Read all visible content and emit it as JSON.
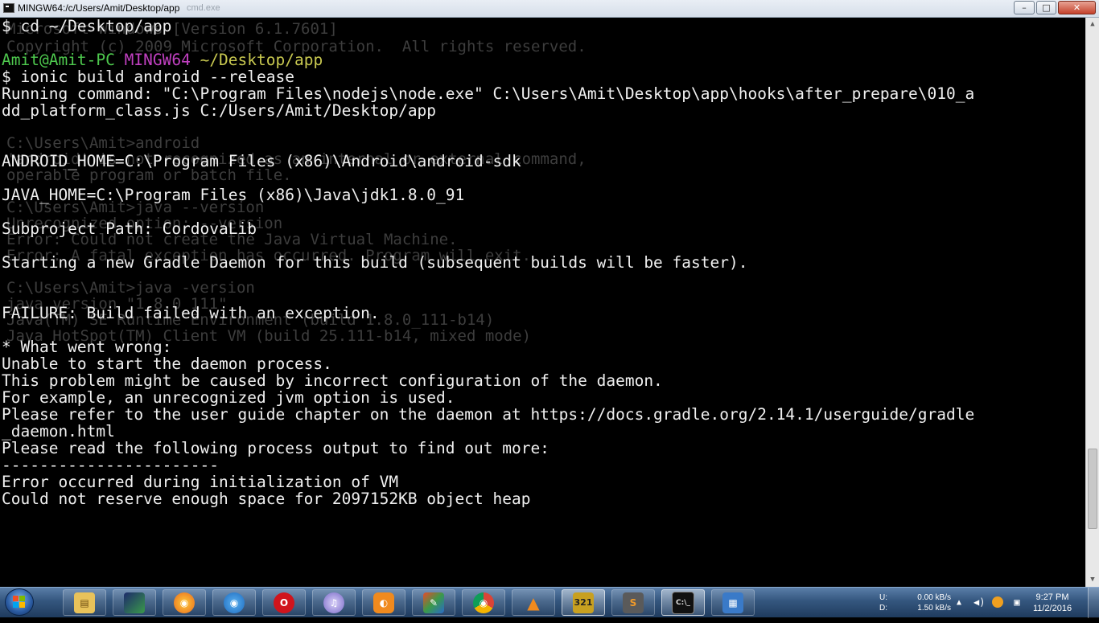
{
  "window": {
    "title": "MINGW64:/c/Users/Amit/Desktop/app",
    "title_ghost": "cmd.exe",
    "controls": {
      "minimize": "–",
      "maximize": "□",
      "close": "✕"
    }
  },
  "terminal": {
    "colors": {
      "background": "#000000",
      "text": "#f0f0f0",
      "user_host": "#4ec94e",
      "mingw": "#c040c0",
      "path": "#c8c850"
    },
    "ghost_text": [
      "Microsoft Windows [Version 6.1.7601]",
      "Copyright (c) 2009 Microsoft Corporation.  All rights reserved.",
      "C:\\Users\\Amit>android",
      "'android' is not recognized as an internal or external command,",
      "operable program or batch file.",
      "C:\\Users\\Amit>java --version",
      "Unrecognized option: --version",
      "Error: Could not create the Java Virtual Machine.",
      "Error: A fatal exception has occurred. Program will exit.",
      "C:\\Users\\Amit>java -version",
      "java version \"1.8.0_111\"",
      "Java(TM) SE Runtime Environment (build 1.8.0_111-b14)",
      "Java HotSpot(TM) Client VM (build 25.111-b14, mixed mode)"
    ],
    "prompt1": "$ cd ~/Desktop/app",
    "prompt2": {
      "user_host": "Amit@Amit-PC",
      "env": "MINGW64",
      "path": "~/Desktop/app"
    },
    "prompt3": "$ ionic build android --release",
    "lines": [
      "Running command: \"C:\\Program Files\\nodejs\\node.exe\" C:\\Users\\Amit\\Desktop\\app\\hooks\\after_prepare\\010_a",
      "dd_platform_class.js C:/Users/Amit/Desktop/app",
      "ANDROID_HOME=C:\\Program Files (x86)\\Android\\android-sdk",
      "JAVA_HOME=C:\\Program Files (x86)\\Java\\jdk1.8.0_91",
      "Subproject Path: CordovaLib",
      "Starting a new Gradle Daemon for this build (subsequent builds will be faster).",
      "FAILURE: Build failed with an exception.",
      "* What went wrong:",
      "Unable to start the daemon process.",
      "This problem might be caused by incorrect configuration of the daemon.",
      "For example, an unrecognized jvm option is used.",
      "Please refer to the user guide chapter on the daemon at https://docs.gradle.org/2.14.1/userguide/gradle",
      "_daemon.html",
      "Please read the following process output to find out more:",
      "-----------------------",
      "Error occurred during initialization of VM",
      "Could not reserve enough space for 2097152KB object heap"
    ]
  },
  "scrollbar": {
    "up": "▲",
    "down": "▼"
  },
  "taskbar": {
    "apps": [
      {
        "name": "windows-explorer",
        "glyph": "▤",
        "color": "#e8c25a"
      },
      {
        "name": "android-studio",
        "glyph": "",
        "color": "#1d2a6b"
      },
      {
        "name": "firefox",
        "glyph": "◉",
        "color": "#e86a1e"
      },
      {
        "name": "app-globe",
        "glyph": "◉",
        "color": "#1e6cc0"
      },
      {
        "name": "opera",
        "glyph": "O",
        "color": "#d0141c"
      },
      {
        "name": "itunes",
        "glyph": "♫",
        "color": "#7a6ac8"
      },
      {
        "name": "uc-browser",
        "glyph": "◐",
        "color": "#f08a1e"
      },
      {
        "name": "paint",
        "glyph": "✎",
        "color": "#3a9a4a"
      },
      {
        "name": "chrome",
        "glyph": "◉",
        "color": "#2a9a4a"
      },
      {
        "name": "vlc",
        "glyph": "▲",
        "color": "#f08a1e"
      },
      {
        "name": "gom-player",
        "glyph": "321",
        "color": "#c8a020"
      },
      {
        "name": "sublime-text",
        "glyph": "S",
        "color": "#5a5a5a"
      },
      {
        "name": "cmd",
        "glyph": "C:\\_",
        "color": "#111111"
      },
      {
        "name": "control-panel",
        "glyph": "▦",
        "color": "#3a7ac8"
      }
    ],
    "drive_labels": [
      "U:",
      "D:"
    ],
    "net_speeds": [
      "0.00 kB/s",
      "1.50 kB/s"
    ],
    "clock": {
      "time": "9:27 PM",
      "date": "11/2/2016"
    }
  }
}
